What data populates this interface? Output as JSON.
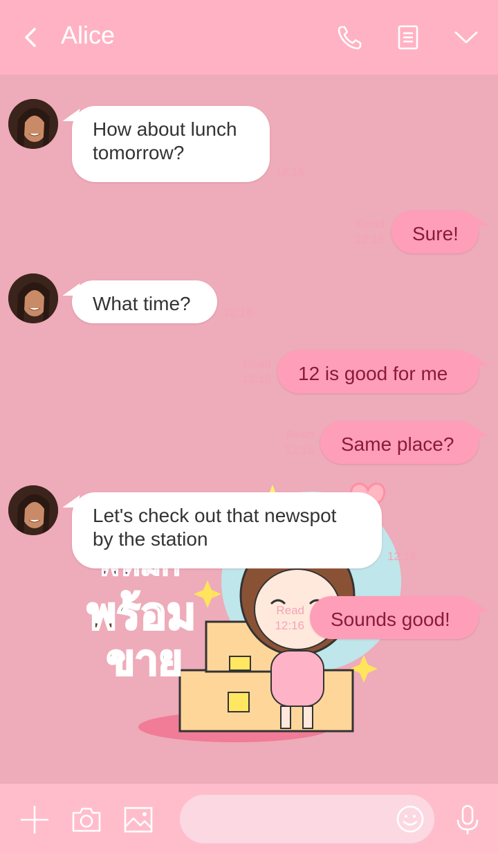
{
  "header": {
    "title": "Alice"
  },
  "messages": [
    {
      "from": "contact",
      "text_line1": "How about lunch",
      "text_line2": "tomorrow?",
      "time": "12:16"
    },
    {
      "from": "me",
      "text": "Sure!",
      "read": "Read",
      "time": "12:16"
    },
    {
      "from": "contact",
      "text": "What time?",
      "time": "12:16"
    },
    {
      "from": "me",
      "text": "12 is good for me",
      "read": "Read",
      "time": "12:16"
    },
    {
      "from": "me",
      "text": "Same place?",
      "read": "Read",
      "time": "12:16"
    },
    {
      "from": "contact",
      "text_line1": "Let's check out that newspot",
      "text_line2": "by the station",
      "time": "12:16"
    },
    {
      "from": "me",
      "text": "Sounds good!",
      "read": "Read",
      "time": "12:16"
    }
  ],
  "sticker": {
    "line1": "พหมก",
    "line2": "พร้อม",
    "line3": "ขาย"
  },
  "composer": {
    "placeholder": ""
  },
  "colors": {
    "header_bg": "#ffb2c3",
    "chat_bg": "#eeabba",
    "outgoing_bubble": "#ff9eb8",
    "incoming_bubble": "#ffffff",
    "composer_bg": "#ffbdcb"
  },
  "icons": {
    "back": "chevron-left-icon",
    "call": "phone-icon",
    "notes": "notes-icon",
    "menu": "chevron-down-icon",
    "add": "plus-icon",
    "camera": "camera-icon",
    "gallery": "image-icon",
    "emoji": "smiley-icon",
    "mic": "microphone-icon"
  }
}
